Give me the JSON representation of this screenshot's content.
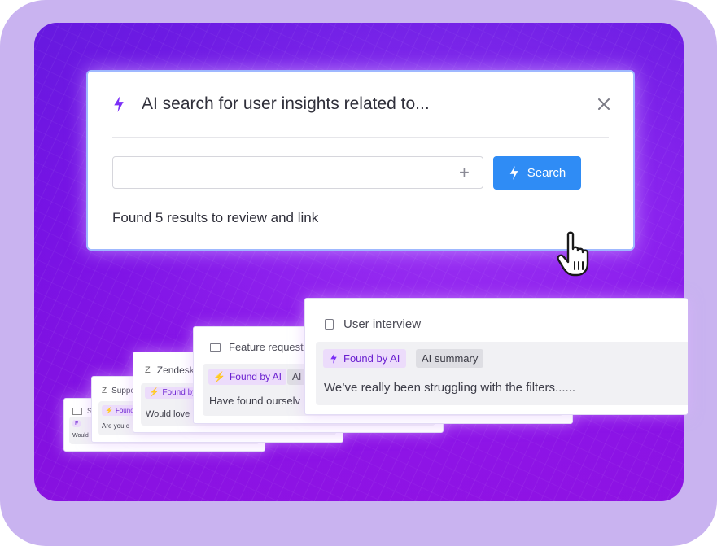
{
  "dialog": {
    "title": "AI search for user insights related to...",
    "search_placeholder": "",
    "search_button": "Search",
    "result_text": "Found 5 results to review and link"
  },
  "cards": {
    "interview": {
      "title": "User interview",
      "tag_ai": "Found by AI",
      "tag_summary": "AI summary",
      "text": "We’ve really been struggling with the filters......"
    },
    "feature": {
      "title": "Feature request",
      "tag_ai": "Found by AI",
      "tag_summary": "AI",
      "text": "Have found ourselv"
    },
    "zendesk": {
      "title": "Zendesk",
      "tag_ai": "Found by",
      "text": "Would love"
    },
    "support": {
      "title": "Suppo",
      "tag_ai": "Found",
      "text": "Are you c"
    },
    "email": {
      "title": "Si",
      "tag_ai": "F",
      "text": "Would"
    }
  },
  "icons": {
    "bolt": "lightning-bolt-icon",
    "close": "close-icon",
    "plus": "plus-icon",
    "cursor": "hand-pointer-icon"
  },
  "colors": {
    "accent": "#2f8cf5",
    "ai_purple": "#7b2ff7",
    "background": "#8a22ee"
  }
}
